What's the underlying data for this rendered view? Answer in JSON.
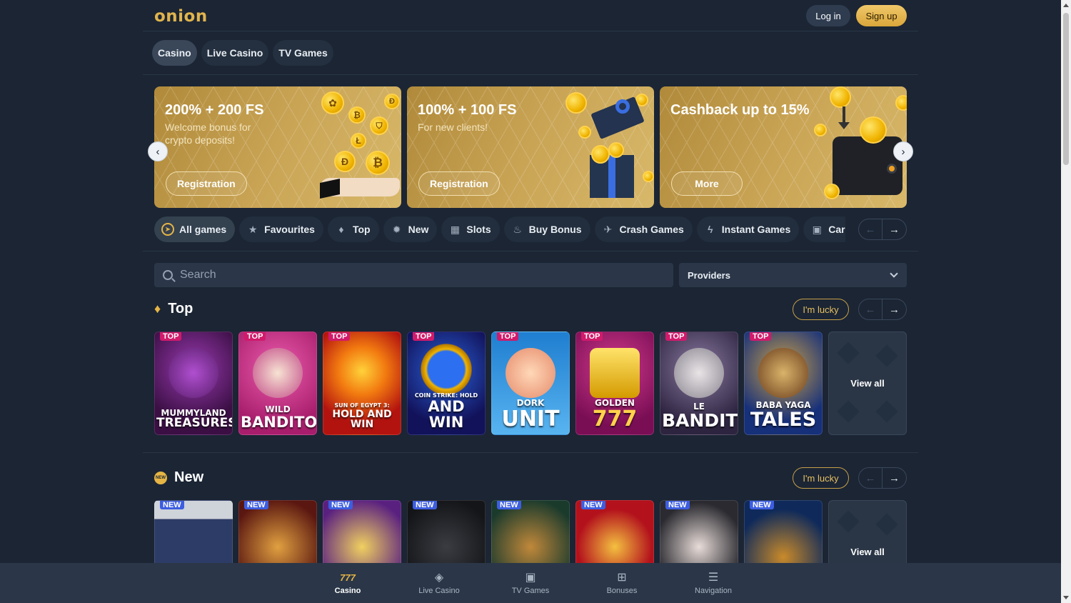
{
  "header": {
    "logo": "onion",
    "login": "Log in",
    "signup": "Sign up"
  },
  "tabs": [
    "Casino",
    "Live Casino",
    "TV Games"
  ],
  "banners": [
    {
      "title": "200% + 200 FS",
      "subtitle": "Welcome bonus for crypto deposits!",
      "button": "Registration"
    },
    {
      "title": "100% + 100 FS",
      "subtitle": "For new clients!",
      "button": "Registration"
    },
    {
      "title": "Cashback up to 15%",
      "subtitle": "",
      "button": "More"
    }
  ],
  "categories": [
    {
      "label": "All games",
      "icon": "compass-icon",
      "glyph": "◉"
    },
    {
      "label": "Favourites",
      "icon": "star-icon",
      "glyph": "★"
    },
    {
      "label": "Top",
      "icon": "flame-icon",
      "glyph": "🜂"
    },
    {
      "label": "New",
      "icon": "new-badge-icon",
      "glyph": "✹"
    },
    {
      "label": "Slots",
      "icon": "slot-machine-icon",
      "glyph": "▦"
    },
    {
      "label": "Buy Bonus",
      "icon": "bonus-icon",
      "glyph": "♨"
    },
    {
      "label": "Crash Games",
      "icon": "crash-icon",
      "glyph": "✈"
    },
    {
      "label": "Instant Games",
      "icon": "lightning-icon",
      "glyph": "ϟ"
    },
    {
      "label": "Cards",
      "icon": "cards-icon",
      "glyph": "▣"
    }
  ],
  "search": {
    "placeholder": "Search",
    "providers": "Providers"
  },
  "sections": {
    "top": {
      "title": "Top",
      "lucky": "I'm lucky",
      "view_all": "View all",
      "badge": "TOP",
      "games": [
        {
          "l1": "MUMMYLAND",
          "l2": "TREASURES",
          "bg": "#5a1e5c"
        },
        {
          "l1": "WILD",
          "l2": "BANDITO",
          "bg": "#c8308a"
        },
        {
          "l1": "SUN OF EGYPT 3:",
          "l2": "HOLD AND WIN",
          "bg": "#d2361a"
        },
        {
          "l1": "COIN STRIKE: HOLD",
          "l2": "AND WIN",
          "bg": "#1f1f7a"
        },
        {
          "l1": "DORK",
          "l2": "UNIT",
          "bg": "#1b8de0"
        },
        {
          "l1": "GOLDEN",
          "l2": "777",
          "bg": "#b21e7c"
        },
        {
          "l1": "LE",
          "l2": "BANDIT",
          "bg": "#4a3a6a"
        },
        {
          "l1": "BABA YAGA",
          "l2": "TALES",
          "bg": "#1d3a9a"
        }
      ]
    },
    "new": {
      "title": "New",
      "lucky": "I'm lucky",
      "view_all": "View all",
      "badge": "NEW",
      "games": [
        {
          "bg": "#3c4a66"
        },
        {
          "bg": "#6b1f12"
        },
        {
          "bg": "#6a2a8c"
        },
        {
          "bg": "#222428"
        },
        {
          "bg": "#1f4a3a"
        },
        {
          "bg": "#b3121c"
        },
        {
          "bg": "#2f2f35"
        },
        {
          "bg": "#0f2a5a"
        }
      ]
    }
  },
  "bottom_nav": [
    {
      "label": "Casino",
      "icon": "casino-777-icon",
      "glyph": "777"
    },
    {
      "label": "Live Casino",
      "icon": "live-cards-icon",
      "glyph": "🂡"
    },
    {
      "label": "TV Games",
      "icon": "tv-icon",
      "glyph": "▣"
    },
    {
      "label": "Bonuses",
      "icon": "gift-icon",
      "glyph": "⊞"
    },
    {
      "label": "Navigation",
      "icon": "menu-search-icon",
      "glyph": "☰"
    }
  ],
  "colors": {
    "background": "#1b2534",
    "accent": "#e6b545",
    "top_badge": "#d11a6b",
    "new_badge": "#3d5ee0"
  }
}
